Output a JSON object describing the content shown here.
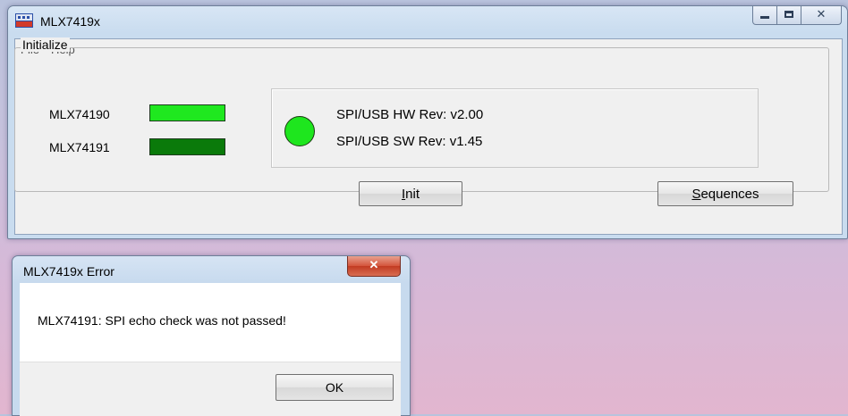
{
  "main_window": {
    "title": "MLX7419x",
    "menu": [
      "File",
      "Help"
    ],
    "group_title": "Initialize",
    "chips": [
      {
        "label": "MLX74190",
        "status_color": "#1fe81f"
      },
      {
        "label": "MLX74191",
        "status_color": "#0a7a0a"
      }
    ],
    "status_indicator_color": "#1ee61e",
    "hw_rev": "SPI/USB HW Rev: v2.00",
    "sw_rev": "SPI/USB SW Rev: v1.45",
    "init_button": {
      "mnemonic": "I",
      "rest": "nit"
    },
    "sequences_button": {
      "mnemonic": "S",
      "rest": "equences"
    }
  },
  "error_dialog": {
    "title": "MLX7419x Error",
    "message": "MLX74191: SPI echo check was not passed!",
    "ok_label": "OK"
  }
}
